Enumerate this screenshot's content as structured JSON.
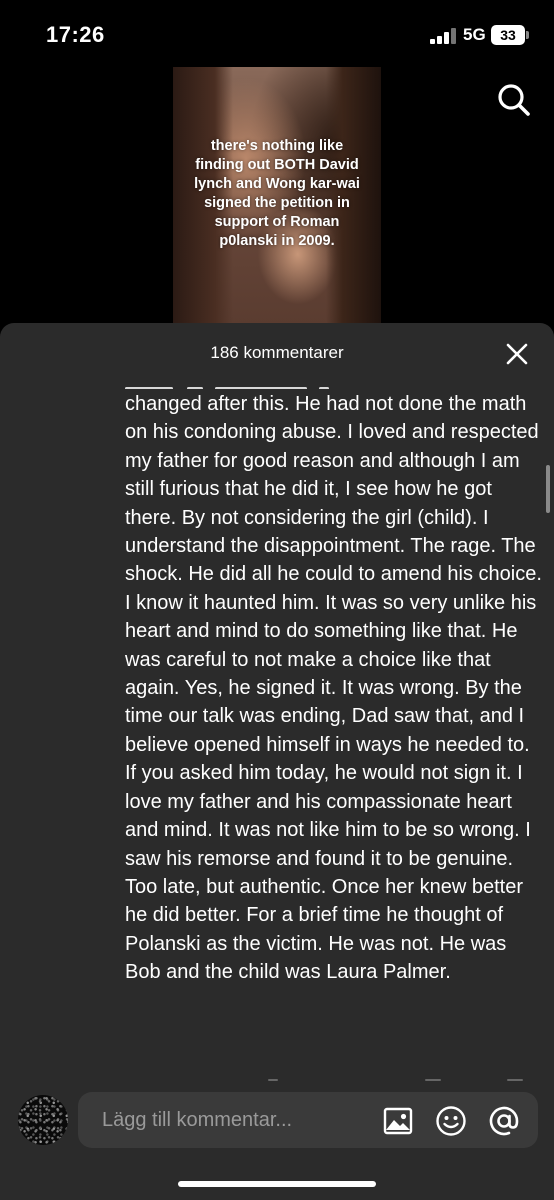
{
  "status_bar": {
    "time": "17:26",
    "network": "5G",
    "battery": "33"
  },
  "video": {
    "caption": "there's nothing like finding out BOTH David lynch and Wong kar-wai signed the petition in support of Roman p0lanski in 2009."
  },
  "comments": {
    "header": "186 kommentarer",
    "body": "changed after this. He had not done the math on his condoning abuse. I loved and respected my father for good reason and although I am still furious that he did it, I see how he got there. By not considering the girl (child). I understand the disappointment. The rage. The shock. He did all he could to amend his choice. I know it haunted him. It was so very unlike his heart and mind to do something like that. He was careful to not make a choice like that again. Yes, he signed it. It was wrong. By the time our talk was ending, Dad saw that, and I believe opened himself in ways he needed to. If you asked him today, he would not sign it. I love my father and his compassionate heart and mind. It was not like him to be so wrong. I saw his remorse and found it to be genuine. Too late, but authentic. Once her knew better he did better. For a brief time he thought of Polanski as the victim. He was not. He was Bob and the child was Laura Palmer."
  },
  "input": {
    "placeholder": "Lägg till kommentar..."
  },
  "icons": {
    "search": "search-icon",
    "close": "close-icon",
    "image": "image-icon",
    "emoji": "emoji-icon",
    "mention": "at-icon"
  },
  "colors": {
    "sheet_bg": "#2b2b2b",
    "input_bg": "#3a3a3a",
    "placeholder": "#9a9a9a"
  }
}
